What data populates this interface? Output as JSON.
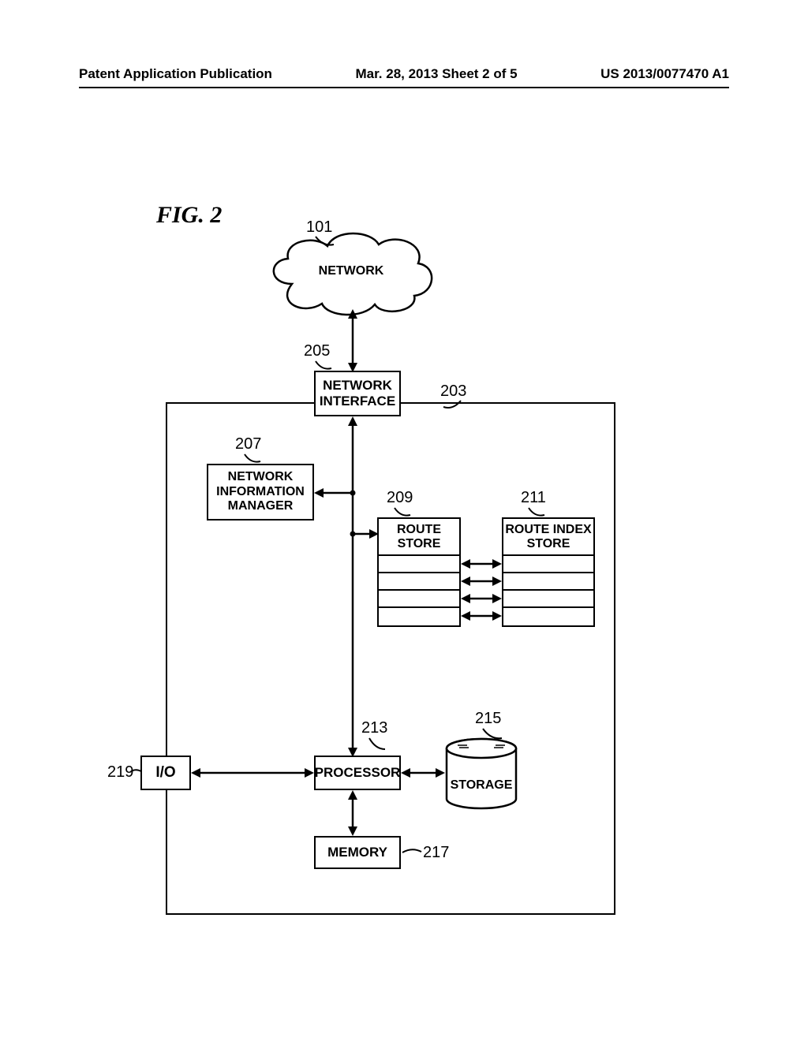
{
  "header": {
    "left": "Patent Application Publication",
    "center": "Mar. 28, 2013  Sheet 2 of 5",
    "right": "US 2013/0077470 A1"
  },
  "figure_label": "FIG. 2",
  "refs": {
    "r101": "101",
    "r203": "203",
    "r205": "205",
    "r207": "207",
    "r209": "209",
    "r211": "211",
    "r213": "213",
    "r215": "215",
    "r217": "217",
    "r219": "219"
  },
  "blocks": {
    "network": "NETWORK",
    "netif_l1": "NETWORK",
    "netif_l2": "INTERFACE",
    "nim_l1": "NETWORK",
    "nim_l2": "INFORMATION",
    "nim_l3": "MANAGER",
    "route_l1": "ROUTE",
    "route_l2": "STORE",
    "ridx_l1": "ROUTE INDEX",
    "ridx_l2": "STORE",
    "processor": "PROCESSOR",
    "storage": "STORAGE",
    "memory": "MEMORY",
    "io": "I/O"
  }
}
